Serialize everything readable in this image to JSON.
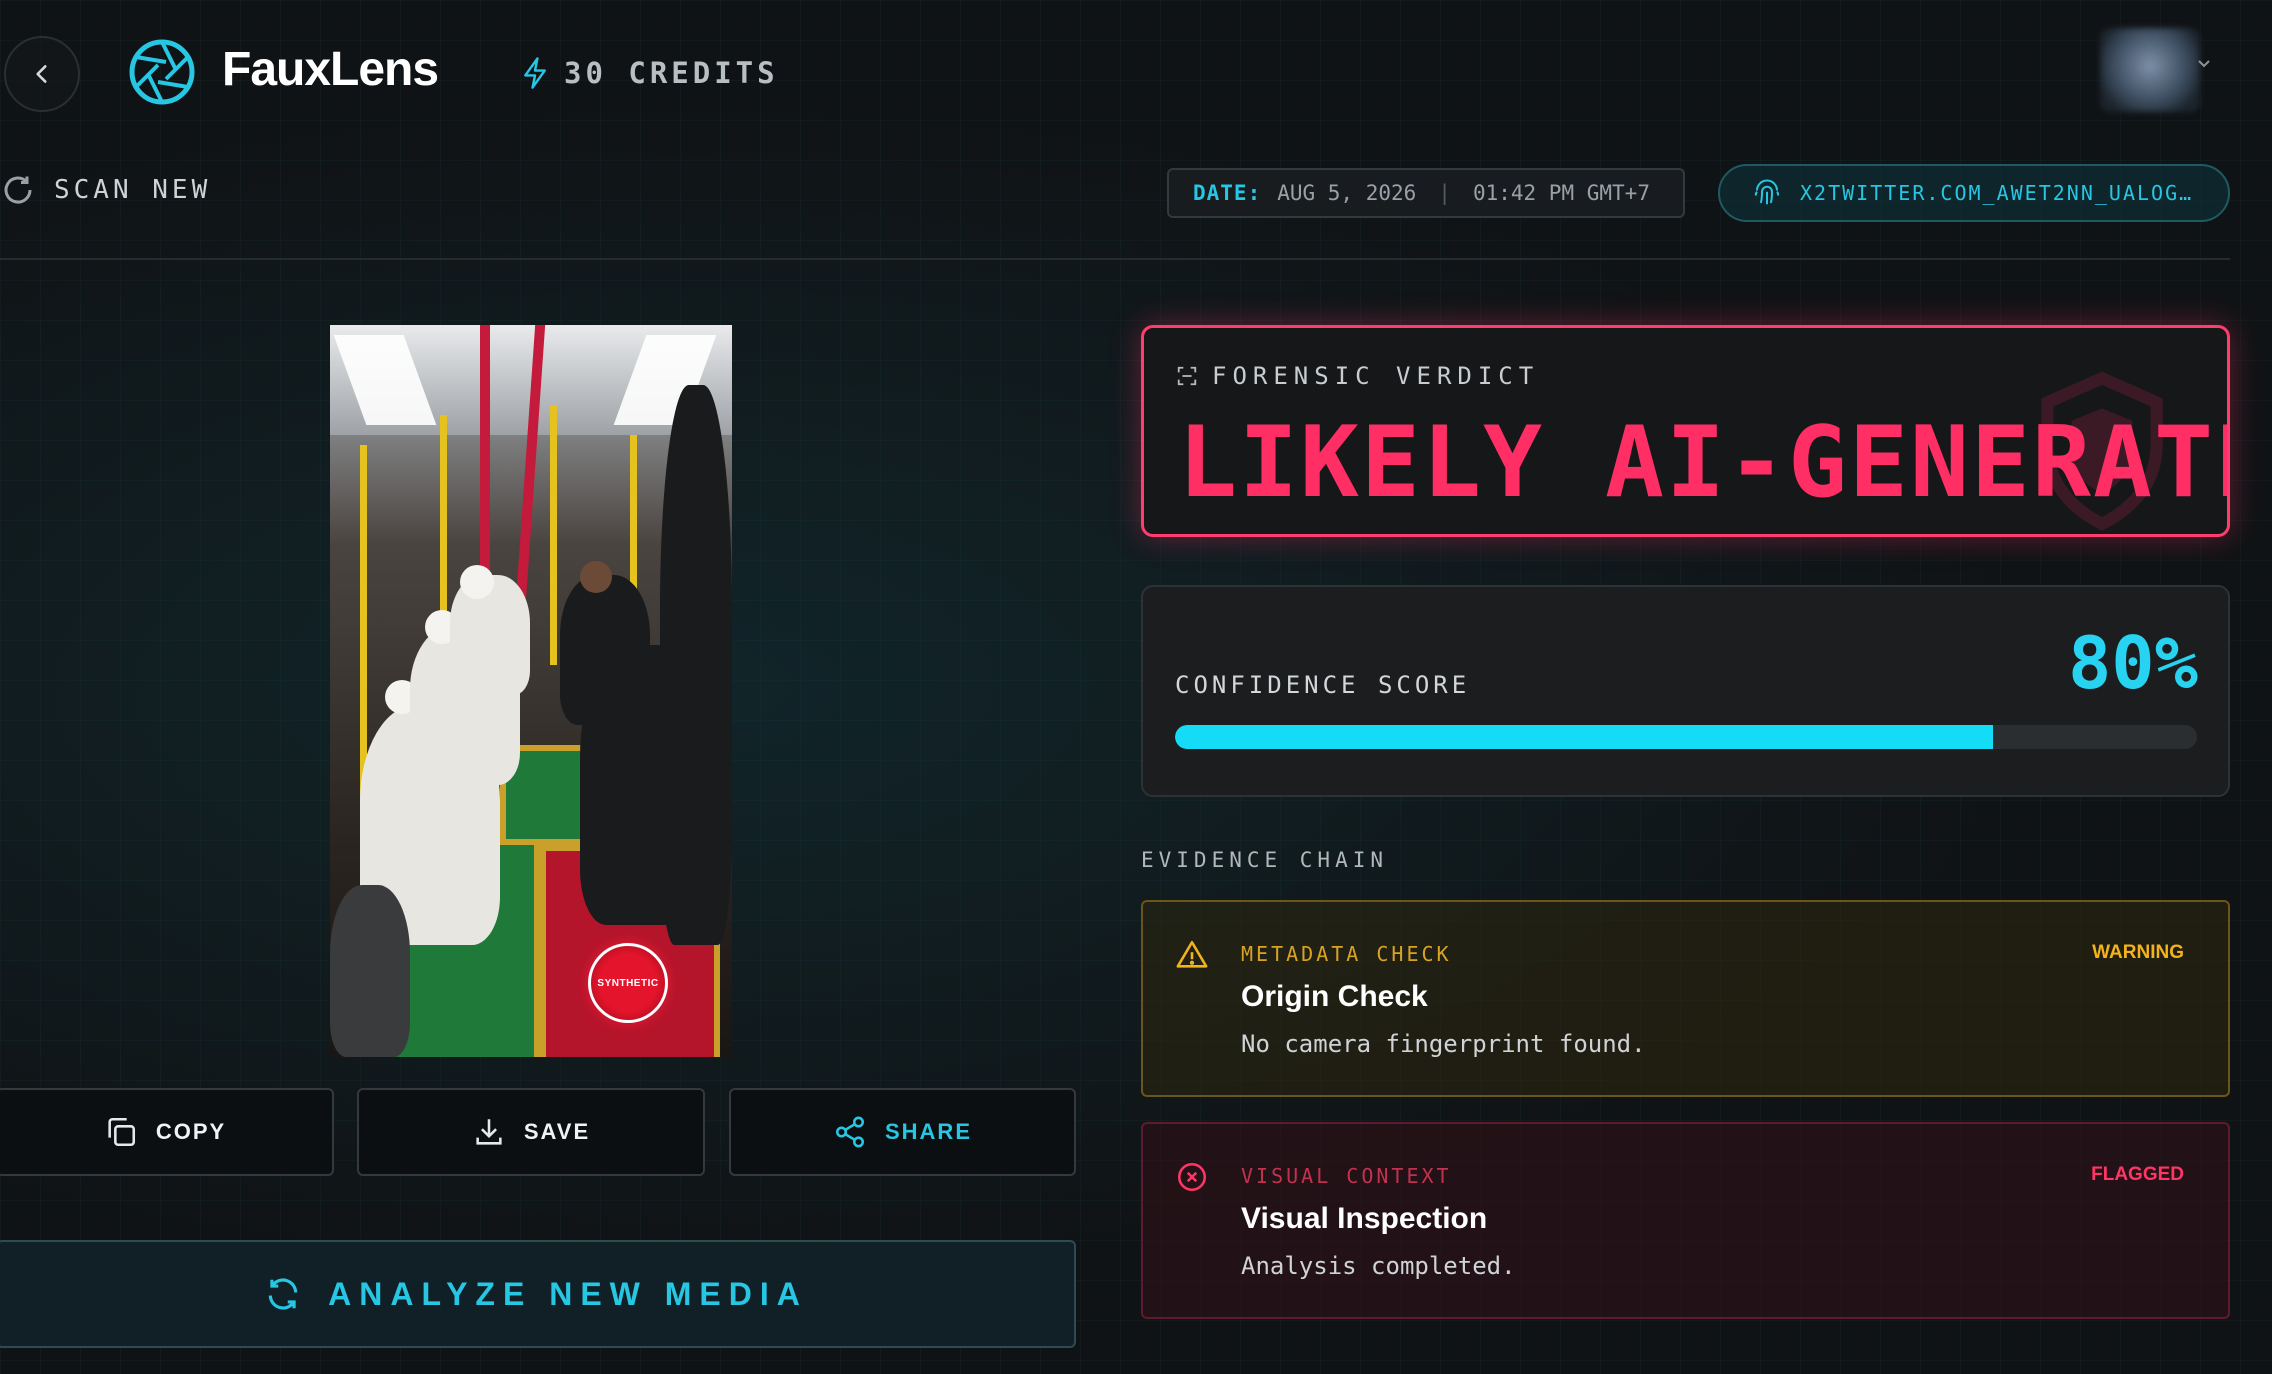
{
  "header": {
    "brand": "FauxLens",
    "credits": "30 CREDITS",
    "accent": "#27c6e3"
  },
  "toolbar": {
    "scan_new": "SCAN NEW",
    "date_key": "DATE:",
    "date_value": "AUG 5, 2026",
    "time_value": "01:42 PM GMT+7",
    "source": "X2TWITTER.COM_AWET2NN_UALOG…"
  },
  "media": {
    "watermark": "SYNTHETIC"
  },
  "actions": {
    "copy": "COPY",
    "save": "SAVE",
    "share": "SHARE",
    "analyze": "ANALYZE NEW MEDIA"
  },
  "verdict": {
    "label": "FORENSIC VERDICT",
    "value": "LIKELY AI-GENERATED",
    "color": "#ff2f66"
  },
  "confidence": {
    "label": "CONFIDENCE SCORE",
    "display": "80%",
    "fraction": 0.8
  },
  "evidence": {
    "title": "EVIDENCE CHAIN",
    "items": [
      {
        "category": "METADATA CHECK",
        "status": "WARNING",
        "title": "Origin Check",
        "description": "No camera fingerprint found.",
        "icon": "warning-triangle-icon",
        "color": "#d9a322"
      },
      {
        "category": "VISUAL CONTEXT",
        "status": "FLAGGED",
        "title": "Visual Inspection",
        "description": "Analysis completed.",
        "icon": "x-circle-icon",
        "color": "#ff3566"
      }
    ]
  }
}
